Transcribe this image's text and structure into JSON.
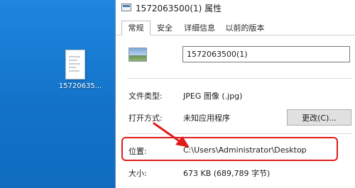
{
  "desktop": {
    "file_label": "15720635..."
  },
  "dialog": {
    "title": "1572063500(1) 属性",
    "tabs": [
      {
        "label": "常规",
        "active": true
      },
      {
        "label": "安全",
        "active": false
      },
      {
        "label": "详细信息",
        "active": false
      },
      {
        "label": "以前的版本",
        "active": false
      }
    ],
    "file_name": "1572063500(1)",
    "file_type_label": "文件类型:",
    "file_type_value": "JPEG 图像 (.jpg)",
    "open_with_label": "打开方式:",
    "open_with_value": "未知应用程序",
    "change_button": "更改(C)...",
    "location_label": "位置:",
    "location_value": "C:\\Users\\Administrator\\Desktop",
    "size_label": "大小:",
    "size_value": "673 KB (689,789 字节)"
  },
  "colors": {
    "highlight": "#e21b1b",
    "desktop": "#1373c9"
  }
}
